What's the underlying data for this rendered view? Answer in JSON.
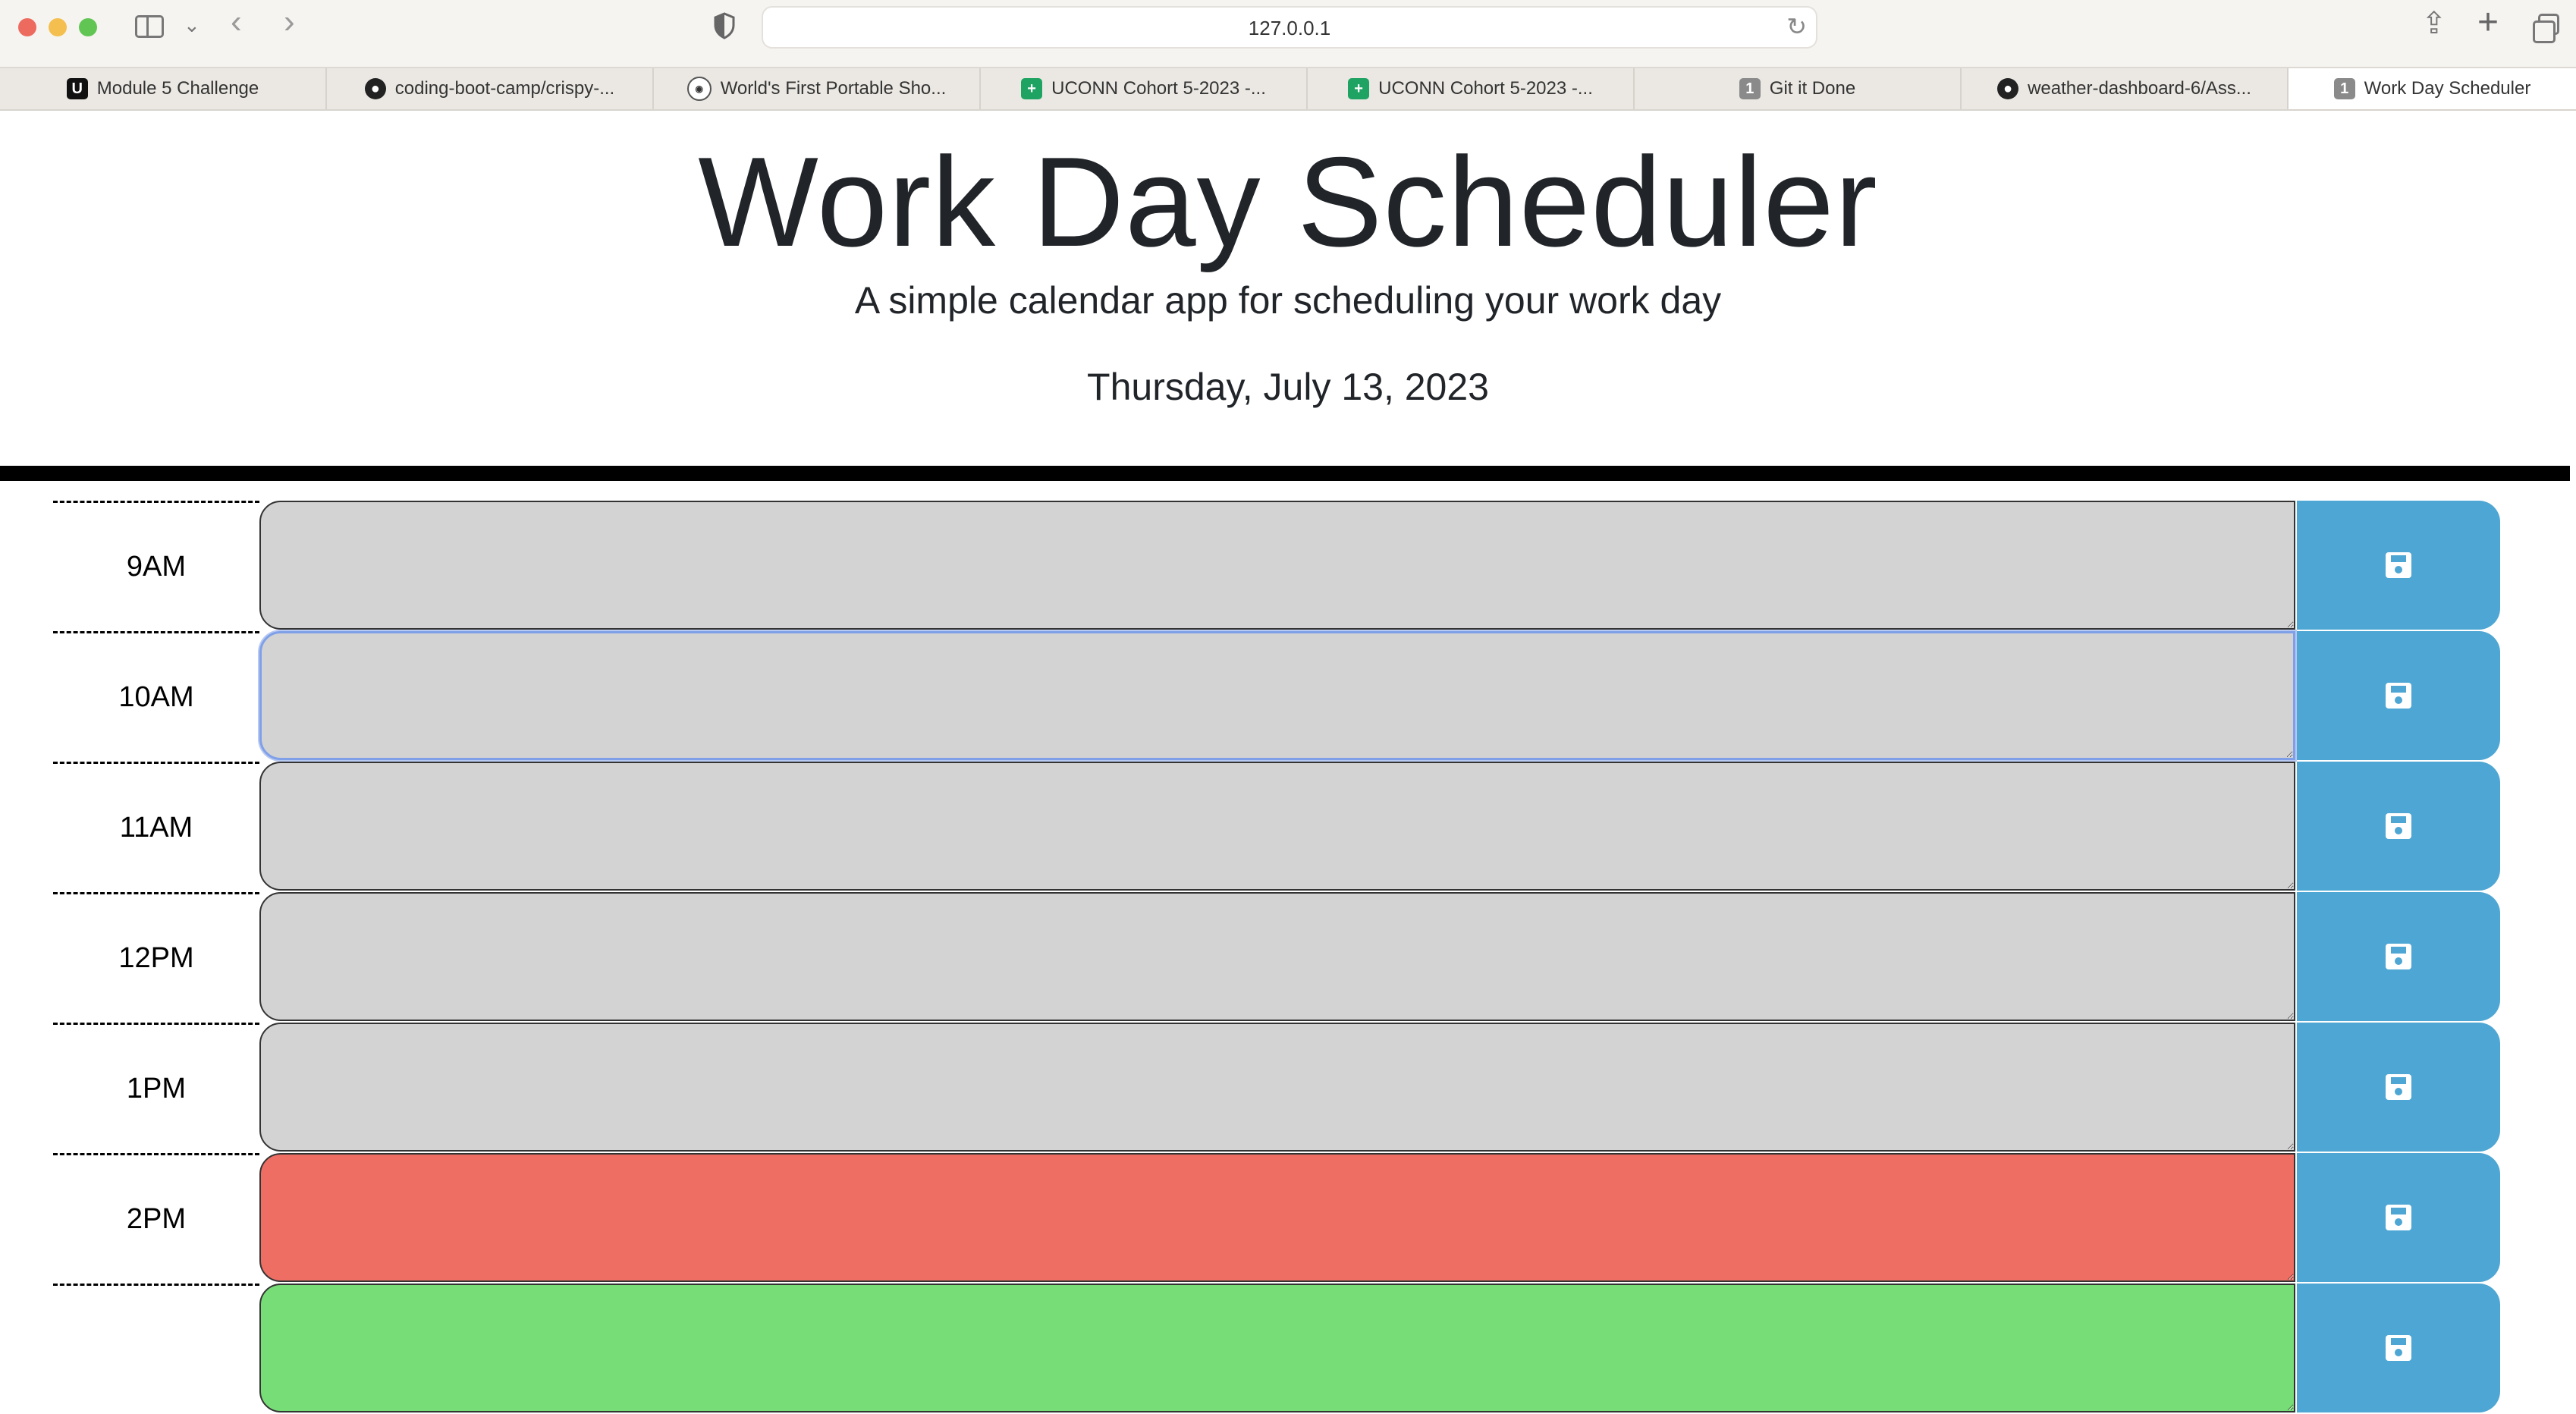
{
  "browser": {
    "url": "127.0.0.1",
    "tabs": [
      {
        "label": "Module 5 Challenge",
        "icon": "U"
      },
      {
        "label": "coding-boot-camp/crispy-...",
        "icon": "github-icon"
      },
      {
        "label": "World's First Portable Sho...",
        "icon": "site-icon"
      },
      {
        "label": "UCONN Cohort 5-2023 -...",
        "icon": "sheets-icon"
      },
      {
        "label": "UCONN Cohort 5-2023 -...",
        "icon": "sheets-icon"
      },
      {
        "label": "Git it Done",
        "icon": "1"
      },
      {
        "label": "weather-dashboard-6/Ass...",
        "icon": "github-icon"
      },
      {
        "label": "Work Day Scheduler",
        "icon": "1"
      }
    ]
  },
  "header": {
    "title": "Work Day Scheduler",
    "lead": "A simple calendar app for scheduling your work day",
    "current_day": "Thursday, July 13, 2023"
  },
  "colors": {
    "past": "#d3d3d3",
    "present": "#ef6e64",
    "future": "#77dd77",
    "save_button": "#4da6d3"
  },
  "schedule": {
    "hours": [
      {
        "label": "9AM",
        "state": "past",
        "text": ""
      },
      {
        "label": "10AM",
        "state": "past",
        "text": ""
      },
      {
        "label": "11AM",
        "state": "past",
        "text": ""
      },
      {
        "label": "12PM",
        "state": "past",
        "text": ""
      },
      {
        "label": "1PM",
        "state": "past",
        "text": ""
      },
      {
        "label": "2PM",
        "state": "present",
        "text": ""
      },
      {
        "label": "",
        "state": "future",
        "text": ""
      }
    ]
  }
}
